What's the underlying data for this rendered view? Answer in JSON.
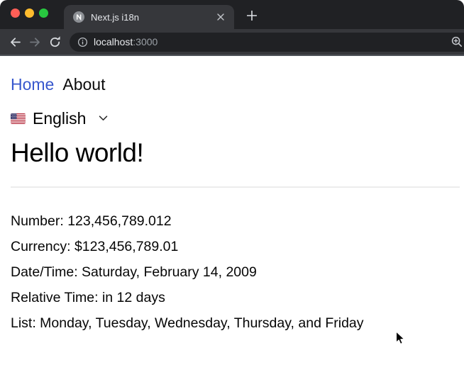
{
  "window": {
    "controls": [
      {
        "name": "close",
        "color": "#ff5f57"
      },
      {
        "name": "minimize",
        "color": "#febc2e"
      },
      {
        "name": "maximize",
        "color": "#28c840"
      }
    ]
  },
  "browser": {
    "tab_title": "Next.js i18n",
    "url_host": "localhost",
    "url_port": ":3000",
    "icons": {
      "favicon": "nextjs-logo-icon",
      "tab_close": "close-icon",
      "new_tab": "plus-icon",
      "back": "back-arrow-icon",
      "forward": "forward-arrow-icon",
      "reload": "reload-icon",
      "site_info": "info-icon",
      "zoom": "zoom-in-icon"
    }
  },
  "page": {
    "nav": [
      {
        "label": "Home",
        "active": true
      },
      {
        "label": "About",
        "active": false
      }
    ],
    "language_selector": {
      "flag": "us-flag-icon",
      "label": "English",
      "chevron": "chevron-down-icon"
    },
    "heading": "Hello world!",
    "facts": [
      "Number: 123,456,789.012",
      "Currency: $123,456,789.01",
      "Date/Time: Saturday, February 14, 2009",
      "Relative Time: in 12 days",
      "List: Monday, Tuesday, Wednesday, Thursday, and Friday"
    ]
  },
  "colors": {
    "link": "#3757cd",
    "chrome_frame": "#202124",
    "chrome_toolbar": "#36373b",
    "omnibox": "#202124",
    "page_bg": "#ffffff"
  }
}
